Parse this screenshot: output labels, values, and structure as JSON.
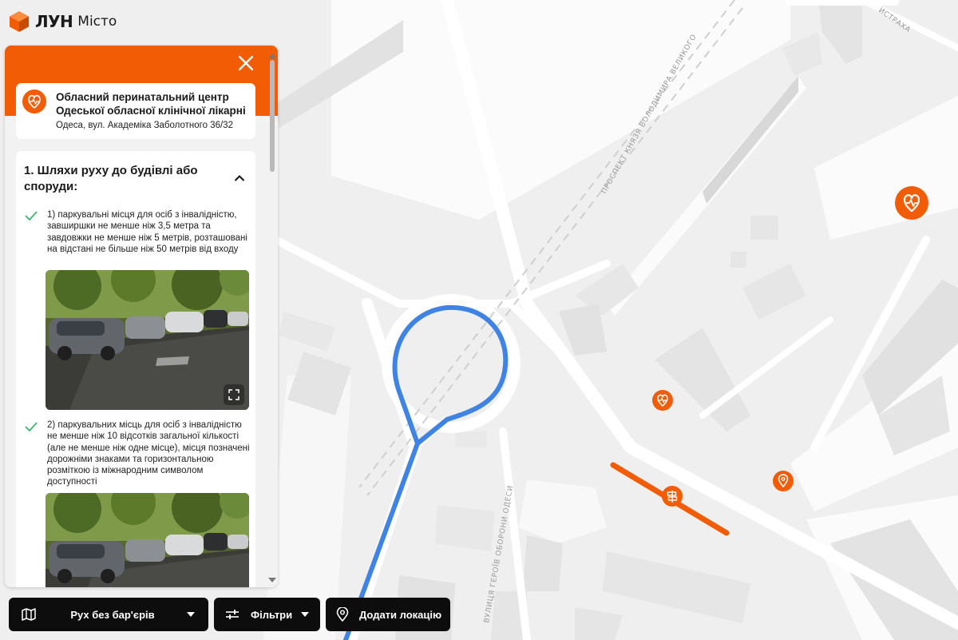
{
  "app": {
    "brand": "ЛУН",
    "product": "Місто"
  },
  "colors": {
    "accent": "#f25c05",
    "route": "#3f84e5",
    "check": "#3cb371",
    "toolbar": "#0d0d0d"
  },
  "panel": {
    "close_icon": "close-icon",
    "location": {
      "icon": "heart-pulse-icon",
      "title": "Обласний перинатальний центр Одеської обласної клінічної лікарні",
      "address": "Одеса, вул. Академіка Заболотного 36/32"
    },
    "section": {
      "title": "1. Шляхи руху до будівлі або споруди:",
      "items": [
        {
          "text": "1) паркувальні місця для осіб з інвалідністю, завширшки не менше ніж 3,5 метра та завдовжки не менше ніж 5 метрів, розташовані на відстані не більше ніж 50 метрів від входу",
          "photo": "parking-lot-photo"
        },
        {
          "text": "2) паркувальних місць для осіб з інвалідністю не менше ніж 10 відсотків загальної кількості (але не менше ніж одне місце), місця позначені дорожніми знаками та горизонтальною розміткою із міжнародним символом доступності",
          "photo": "parking-lot-photo"
        }
      ]
    }
  },
  "map": {
    "streets": [
      "ПРОСПЕКТ КНЯЗЯ ВОЛОДИМИРА ВЕЛИКОГО",
      "ВУЛИЦЯ ГЕРОЇВ ОБОРОНИ ОДЕСИ",
      "ИСТРАХА"
    ],
    "markers": [
      "heart-pulse-marker",
      "heart-pulse-marker",
      "location-marker",
      "signpost-marker"
    ]
  },
  "toolbar": {
    "mode": {
      "label": "Рух без бар'єрів",
      "icon": "map-icon"
    },
    "filters": {
      "label": "Фільтри",
      "icon": "sliders-icon"
    },
    "add": {
      "label": "Додати локацію",
      "icon": "map-pin-icon"
    }
  }
}
